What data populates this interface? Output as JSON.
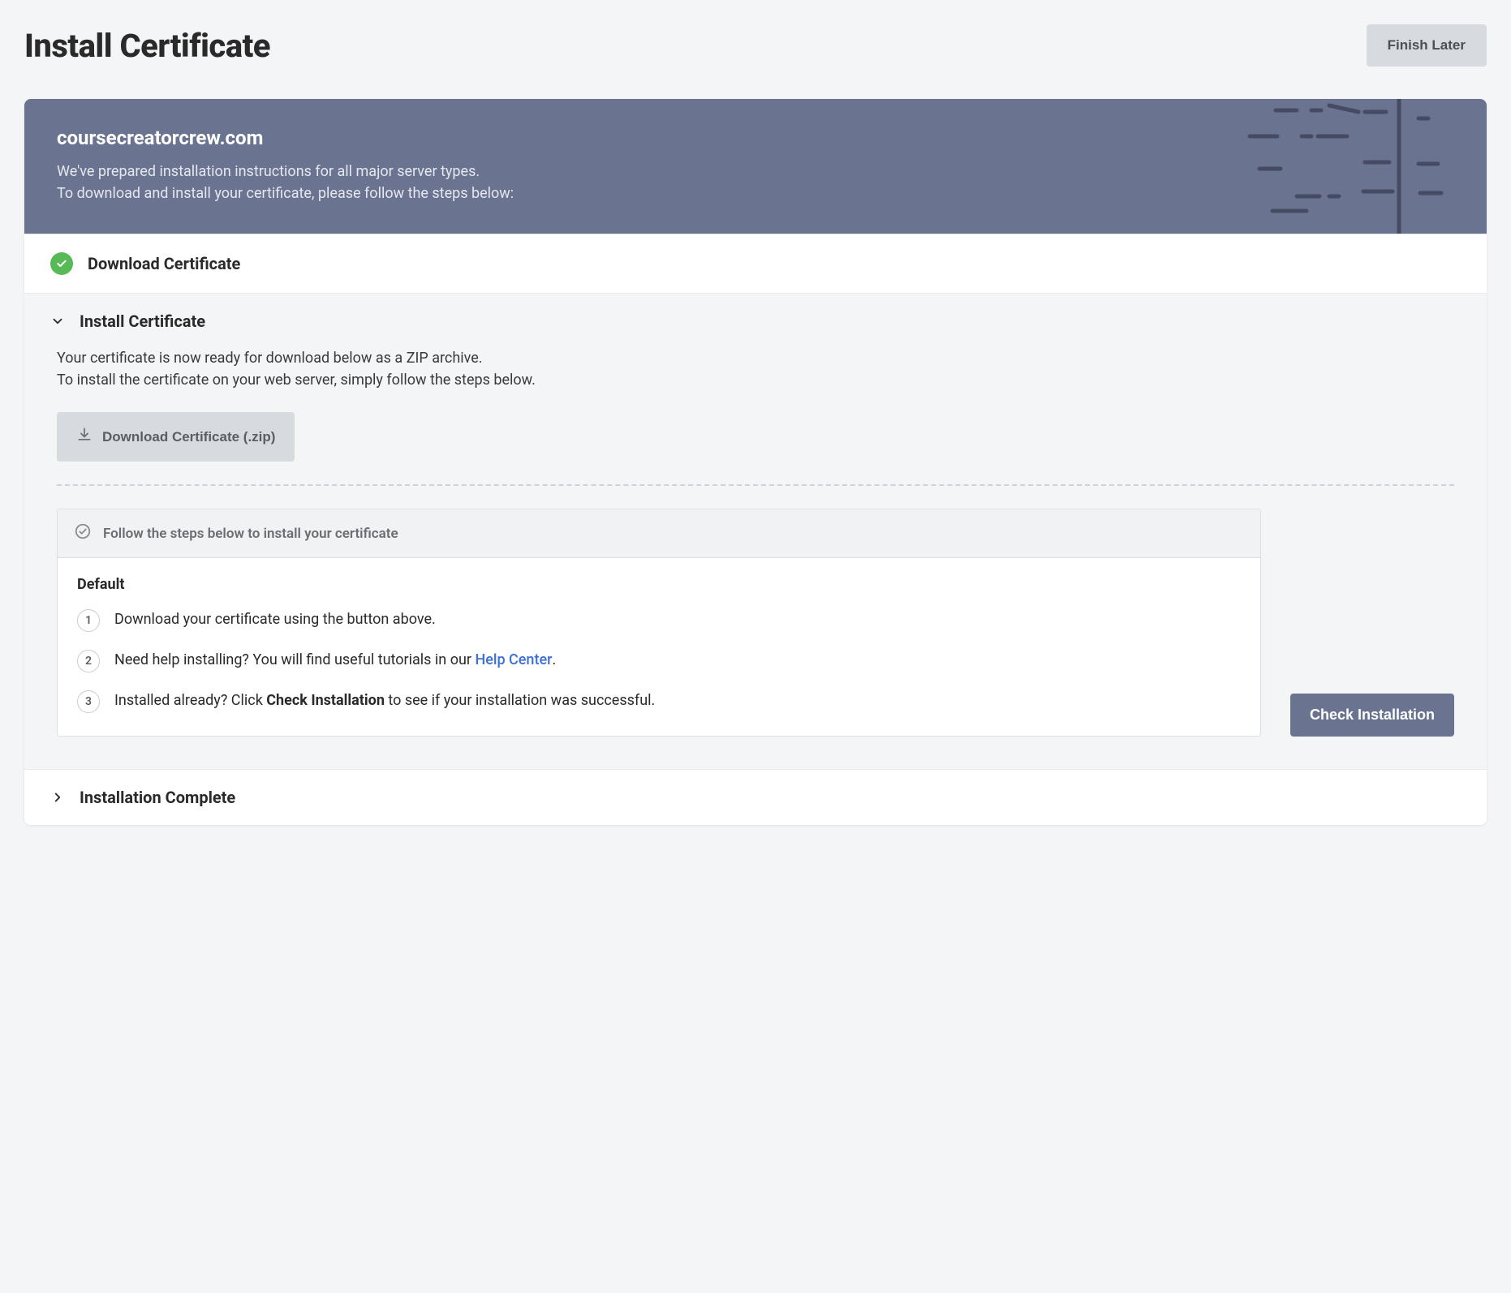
{
  "page": {
    "title": "Install Certificate",
    "finish_later": "Finish Later"
  },
  "banner": {
    "domain": "coursecreatorcrew.com",
    "text_line1": "We've prepared installation instructions for all major server types.",
    "text_line2": "To download and install your certificate, please follow the steps below:"
  },
  "sections": {
    "download": {
      "title": "Download Certificate",
      "status": "complete"
    },
    "install": {
      "title": "Install Certificate",
      "lead_line1": "Your certificate is now ready for download below as a ZIP archive.",
      "lead_line2": "To install the certificate on your web server, simply follow the steps below.",
      "download_button": "Download Certificate (.zip)",
      "instruction_header": "Follow the steps below to install your certificate",
      "instruction_subtitle": "Default",
      "steps": {
        "s1": "Download your certificate using the button above.",
        "s2_prefix": "Need help installing? You will find useful tutorials in our ",
        "s2_link": "Help Center",
        "s2_suffix": ".",
        "s3_prefix": "Installed already? Click ",
        "s3_bold": "Check Installation",
        "s3_suffix": " to see if your installation was successful."
      },
      "check_button": "Check Installation"
    },
    "complete": {
      "title": "Installation Complete"
    }
  }
}
